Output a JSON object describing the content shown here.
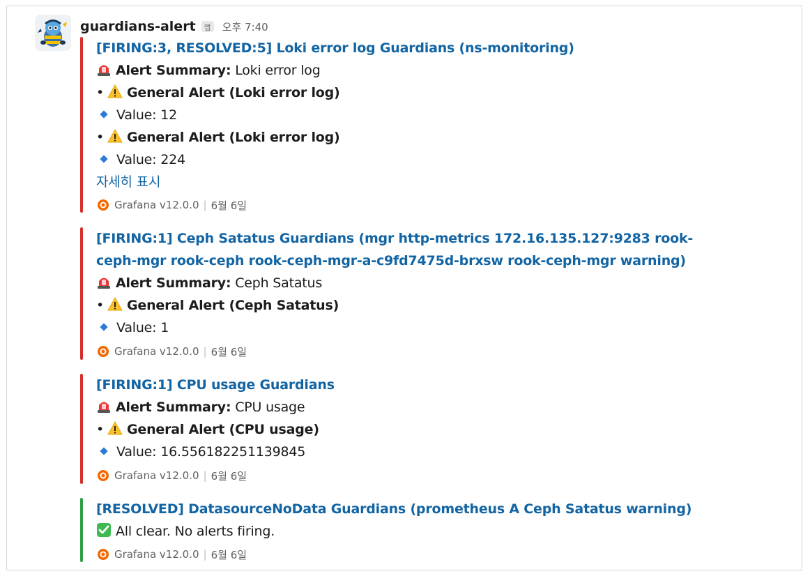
{
  "message": {
    "sender": "guardians-alert",
    "app_badge": "앱",
    "time": "오후 7:40"
  },
  "colors": {
    "firing": "#d5312c",
    "resolved": "#2ea043",
    "link": "#1264a3"
  },
  "attachments": [
    {
      "status": "firing",
      "title_lines": [
        "[FIRING:3, RESOLVED:5] Loki error log Guardians (ns-monitoring)"
      ],
      "summary_label": "Alert Summary:",
      "summary_value": " Loki error log",
      "alerts": [
        {
          "name": "General Alert (Loki error log)",
          "value": "Value: 12"
        },
        {
          "name": "General Alert (Loki error log)",
          "value": "Value: 224"
        }
      ],
      "more": "자세히 표시",
      "footer_source": "Grafana v12.0.0",
      "footer_date": "6월 6일"
    },
    {
      "status": "firing",
      "title_lines": [
        "[FIRING:1] Ceph Satatus Guardians (mgr http-metrics 172.16.135.127:9283 rook-",
        "ceph-mgr rook-ceph rook-ceph-mgr-a-c9fd7475d-brxsw rook-ceph-mgr warning)"
      ],
      "summary_label": "Alert Summary:",
      "summary_value": " Ceph Satatus",
      "alerts": [
        {
          "name": "General Alert (Ceph Satatus)",
          "value": "Value: 1"
        }
      ],
      "footer_source": "Grafana v12.0.0",
      "footer_date": "6월 6일"
    },
    {
      "status": "firing",
      "title_lines": [
        "[FIRING:1] CPU usage Guardians"
      ],
      "summary_label": "Alert Summary:",
      "summary_value": " CPU usage",
      "alerts": [
        {
          "name": "General Alert (CPU usage)",
          "value": "Value: 16.556182251139845"
        }
      ],
      "footer_source": "Grafana v12.0.0",
      "footer_date": "6월 6일"
    },
    {
      "status": "resolved",
      "title_lines": [
        "[RESOLVED] DatasourceNoData Guardians (prometheus A Ceph Satatus warning)"
      ],
      "clear_text": "All clear. No alerts firing.",
      "footer_source": "Grafana v12.0.0",
      "footer_date": "6월 6일"
    }
  ]
}
